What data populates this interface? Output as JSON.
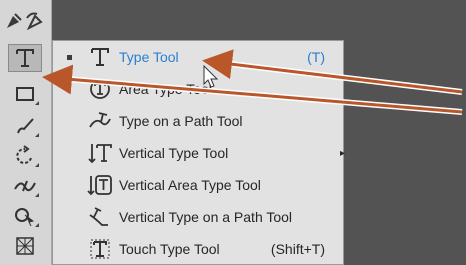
{
  "flyout": {
    "items": [
      {
        "label": "Type Tool",
        "shortcut": "(T)",
        "icon": "type-icon",
        "active": true
      },
      {
        "label": "Area Type Tool",
        "shortcut": "",
        "icon": "area-type-icon",
        "active": false
      },
      {
        "label": "Type on a Path Tool",
        "shortcut": "",
        "icon": "type-on-path-icon",
        "active": false
      },
      {
        "label": "Vertical Type Tool",
        "shortcut": "",
        "icon": "vertical-type-icon",
        "active": false
      },
      {
        "label": "Vertical Area Type Tool",
        "shortcut": "",
        "icon": "vertical-area-type-icon",
        "active": false
      },
      {
        "label": "Vertical Type on a Path Tool",
        "shortcut": "",
        "icon": "vertical-type-on-path-icon",
        "active": false
      },
      {
        "label": "Touch Type Tool",
        "shortcut": "(Shift+T)",
        "icon": "touch-type-icon",
        "active": false
      }
    ]
  },
  "toolbar": {
    "tools": [
      "pen-icon",
      "curvature-icon",
      "type-icon",
      "rectangle-icon",
      "paintbrush-icon",
      "rotate-icon",
      "width-icon",
      "shape-builder-icon",
      "perspective-grid-icon"
    ]
  },
  "colors": {
    "active": "#2a7fd1",
    "arrow": "#b9562a"
  }
}
